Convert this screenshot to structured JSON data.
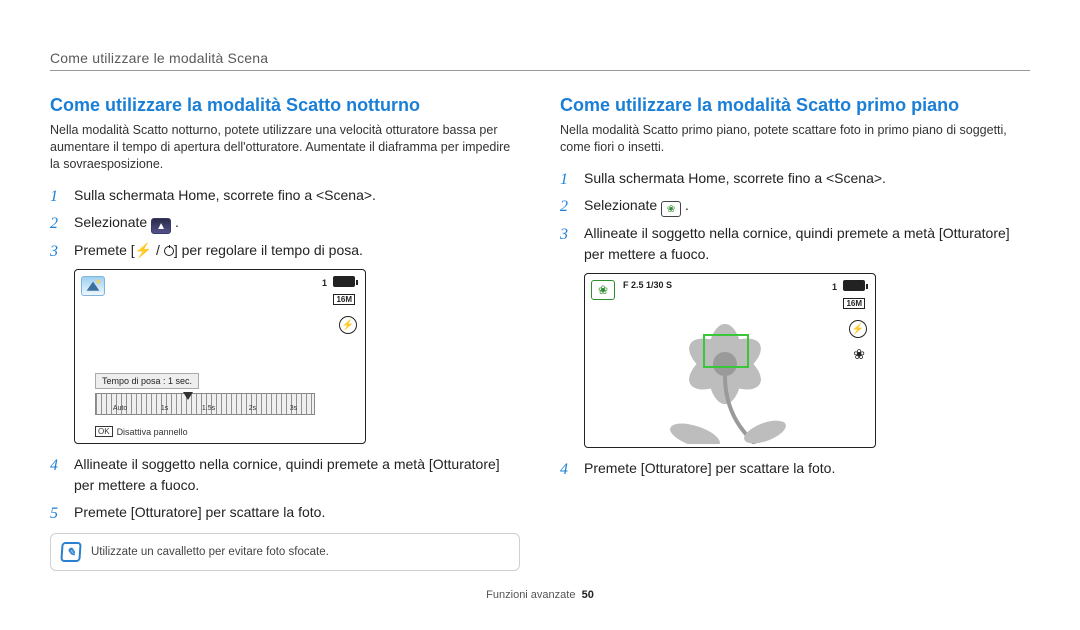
{
  "running_header": "Come utilizzare le modalità Scena",
  "left": {
    "title": "Come utilizzare la modalità Scatto notturno",
    "intro": "Nella modalità Scatto notturno, potete utilizzare una velocità otturatore bassa per aumentare il tempo di apertura dell'otturatore. Aumentate il diaframma per impedire la sovraesposizione.",
    "step1": "Sulla schermata Home, scorrete fino a <Scena>.",
    "step2a": "Selezionate ",
    "step2b": ".",
    "step3a": "Premete [",
    "step3_flash": "⚡",
    "step3_sep": " / ",
    "step3b": "] per regolare il tempo di posa.",
    "screenshot": {
      "counter": "1",
      "resolution": "16M",
      "flash_glyph": "⚡",
      "exposure_label": "Tempo di posa : 1 sec.",
      "ruler_labels": [
        "Auto",
        "1s",
        "1.5s",
        "2s",
        "3s"
      ],
      "ok_label": "OK",
      "ok_text": "Disattiva pannello"
    },
    "step4": "Allineate il soggetto nella cornice, quindi premete a metà [Otturatore] per mettere a fuoco.",
    "step5": "Premete [Otturatore] per scattare la foto.",
    "tip": "Utilizzate un cavalletto per evitare foto sfocate."
  },
  "right": {
    "title": "Come utilizzare la modalità Scatto primo piano",
    "intro": "Nella modalità Scatto primo piano, potete scattare foto in primo piano di soggetti, come fiori o insetti.",
    "step1": "Sulla schermata Home, scorrete fino a <Scena>.",
    "step2a": "Selezionate ",
    "step2b": ".",
    "step3": "Allineate il soggetto nella cornice, quindi premete a metà [Otturatore] per mettere a fuoco.",
    "screenshot": {
      "counter": "1",
      "resolution": "16M",
      "aperture": "F 2.5  1/30 S",
      "flash_glyph": "⚡",
      "macro_glyph": "❀"
    },
    "step4": "Premete [Otturatore] per scattare la foto."
  },
  "footer_label": "Funzioni avanzate",
  "footer_page": "50",
  "icons": {
    "night_glyph": "▲",
    "macro_glyph": "❀"
  }
}
